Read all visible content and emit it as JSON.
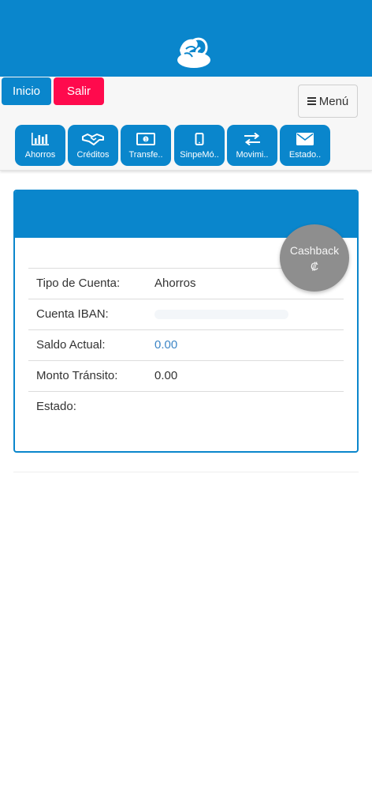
{
  "header": {
    "logo_icon": "hands-logo-icon"
  },
  "nav": {
    "inicio": "Inicio",
    "salir": "Salir",
    "menu": "Menú",
    "quick": [
      {
        "label": "Ahorros",
        "icon": "bar-chart-icon"
      },
      {
        "label": "Créditos",
        "icon": "handshake-icon"
      },
      {
        "label": "Transfe..",
        "icon": "money-icon"
      },
      {
        "label": "SinpeMó..",
        "icon": "mobile-icon"
      },
      {
        "label": "Movimi..",
        "icon": "arrows-exchange-icon"
      },
      {
        "label": "Estado..",
        "icon": "envelope-icon"
      }
    ]
  },
  "account": {
    "rows": [
      {
        "label": "Tipo de Cuenta:",
        "value": "Ahorros"
      },
      {
        "label": "Cuenta IBAN:",
        "value": ""
      },
      {
        "label": "Saldo Actual:",
        "value": "0.00"
      },
      {
        "label": "Monto Tránsito:",
        "value": "0.00"
      },
      {
        "label": "Estado:",
        "value": ""
      }
    ]
  },
  "cashback": {
    "label": "Cashback",
    "symbol": "₡"
  },
  "colors": {
    "primary": "#0a86cc",
    "danger": "#ff0a4d",
    "fab": "#8e8e8e",
    "link": "#3d86c6"
  }
}
